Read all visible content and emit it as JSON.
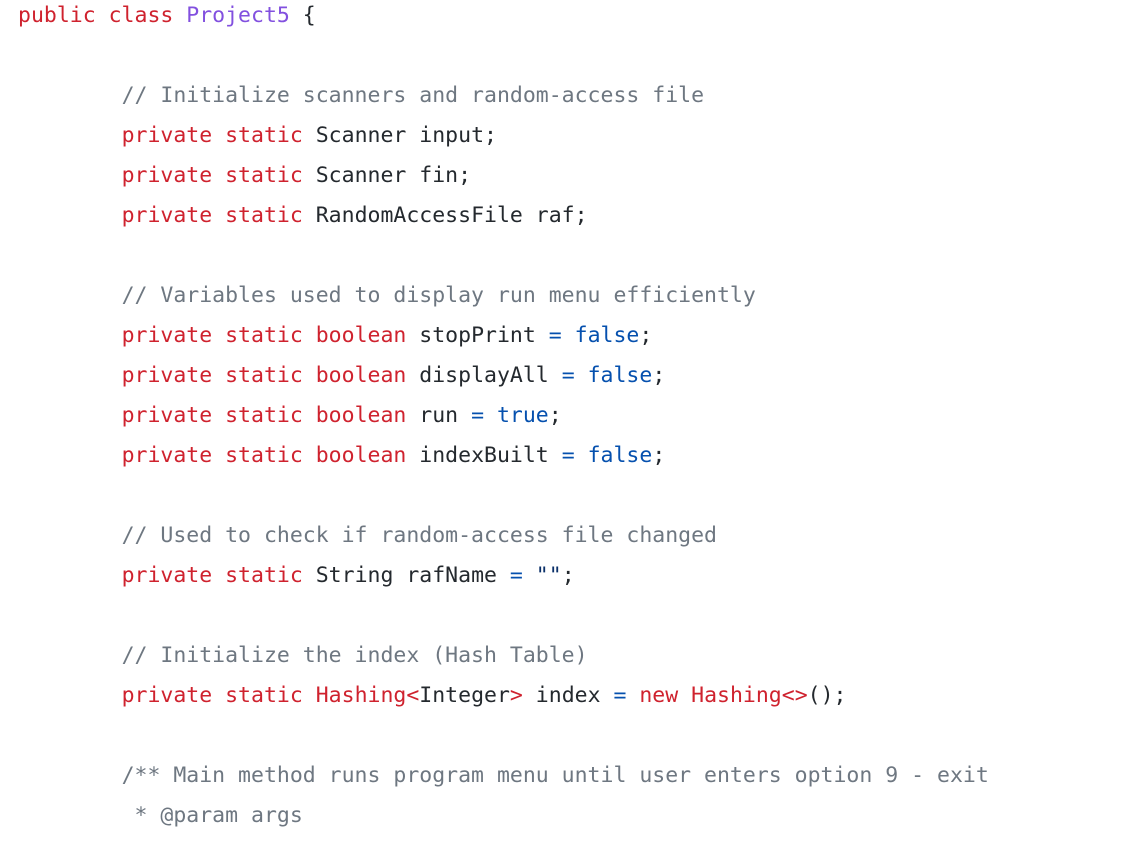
{
  "code_view": {
    "language": "java",
    "colors": {
      "keyword": "#cf222e",
      "class": "#8250df",
      "comment": "#6e7781",
      "literal": "#0550ae",
      "string": "#0a3069",
      "plain": "#24292e",
      "background": "#ffffff"
    },
    "lines": [
      [
        [
          "keyword",
          "public class "
        ],
        [
          "class",
          "Project5"
        ],
        [
          "plain",
          " {"
        ]
      ],
      [],
      [
        [
          "plain",
          "        "
        ],
        [
          "comment",
          "// Initialize scanners and random-access file"
        ]
      ],
      [
        [
          "plain",
          "        "
        ],
        [
          "keyword",
          "private static "
        ],
        [
          "plain",
          "Scanner input;"
        ]
      ],
      [
        [
          "plain",
          "        "
        ],
        [
          "keyword",
          "private static "
        ],
        [
          "plain",
          "Scanner fin;"
        ]
      ],
      [
        [
          "plain",
          "        "
        ],
        [
          "keyword",
          "private static "
        ],
        [
          "plain",
          "RandomAccessFile raf;"
        ]
      ],
      [],
      [
        [
          "plain",
          "        "
        ],
        [
          "comment",
          "// Variables used to display run menu efficiently"
        ]
      ],
      [
        [
          "plain",
          "        "
        ],
        [
          "keyword",
          "private static "
        ],
        [
          "type",
          "boolean "
        ],
        [
          "plain",
          "stopPrint "
        ],
        [
          "operator",
          "= "
        ],
        [
          "literal",
          "false"
        ],
        [
          "plain",
          ";"
        ]
      ],
      [
        [
          "plain",
          "        "
        ],
        [
          "keyword",
          "private static "
        ],
        [
          "type",
          "boolean "
        ],
        [
          "plain",
          "displayAll "
        ],
        [
          "operator",
          "= "
        ],
        [
          "literal",
          "false"
        ],
        [
          "plain",
          ";"
        ]
      ],
      [
        [
          "plain",
          "        "
        ],
        [
          "keyword",
          "private static "
        ],
        [
          "type",
          "boolean "
        ],
        [
          "plain",
          "run "
        ],
        [
          "operator",
          "= "
        ],
        [
          "literal",
          "true"
        ],
        [
          "plain",
          ";"
        ]
      ],
      [
        [
          "plain",
          "        "
        ],
        [
          "keyword",
          "private static "
        ],
        [
          "type",
          "boolean "
        ],
        [
          "plain",
          "indexBuilt "
        ],
        [
          "operator",
          "= "
        ],
        [
          "literal",
          "false"
        ],
        [
          "plain",
          ";"
        ]
      ],
      [],
      [
        [
          "plain",
          "        "
        ],
        [
          "comment",
          "// Used to check if random-access file changed"
        ]
      ],
      [
        [
          "plain",
          "        "
        ],
        [
          "keyword",
          "private static "
        ],
        [
          "plain",
          "String rafName "
        ],
        [
          "operator",
          "= "
        ],
        [
          "string",
          "\"\""
        ],
        [
          "plain",
          ";"
        ]
      ],
      [],
      [
        [
          "plain",
          "        "
        ],
        [
          "comment",
          "// Initialize the index (Hash Table)"
        ]
      ],
      [
        [
          "plain",
          "        "
        ],
        [
          "keyword",
          "private static "
        ],
        [
          "type",
          "Hashing"
        ],
        [
          "keyword",
          "<"
        ],
        [
          "plain",
          "Integer"
        ],
        [
          "keyword",
          ">"
        ],
        [
          "plain",
          " index "
        ],
        [
          "operator",
          "= "
        ],
        [
          "keyword",
          "new "
        ],
        [
          "type",
          "Hashing"
        ],
        [
          "keyword",
          "<>"
        ],
        [
          "plain",
          "();"
        ]
      ],
      [],
      [
        [
          "plain",
          "        "
        ],
        [
          "comment",
          "/** Main method runs program menu until user enters option 9 - exit"
        ]
      ],
      [
        [
          "plain",
          "        "
        ],
        [
          "comment",
          " * @param args"
        ]
      ]
    ]
  }
}
